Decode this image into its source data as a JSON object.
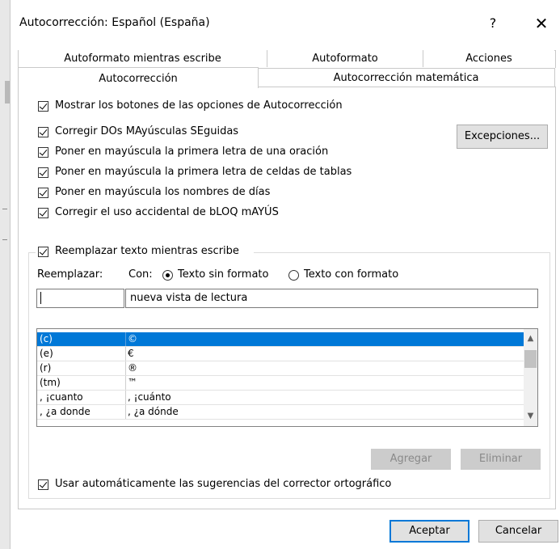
{
  "window": {
    "title": "Autocorrección: Español (España)",
    "help_label": "?",
    "close_label": "✕"
  },
  "tabs": {
    "row_back": [
      "Autoformato mientras escribe",
      "Autoformato",
      "Acciones"
    ],
    "active": "Autocorrección",
    "math": "Autocorrección matemática"
  },
  "options": {
    "show_buttons": "Mostrar los botones de las opciones de Autocorrección",
    "two_caps": "Corregir DOs MAyúsculas SEguidas",
    "sentence_caps": "Poner en mayúscula la primera letra de una oración",
    "table_caps": "Poner en mayúscula la primera letra de celdas de tablas",
    "day_names": "Poner en mayúscula los nombres de días",
    "caps_lock": "Corregir el uso accidental de bLOQ mAYÚS"
  },
  "exceptions_button": "Excepciones...",
  "replace": {
    "group_label": "Reemplazar texto mientras escribe",
    "replace_label": "Reemplazar:",
    "with_label": "Con:",
    "plain_text": "Texto sin formato",
    "formatted_text": "Texto con formato",
    "replace_value": "",
    "with_value": "nueva vista de lectura"
  },
  "list": {
    "rows": [
      {
        "from": "(c)",
        "to": "©"
      },
      {
        "from": "(e)",
        "to": "€"
      },
      {
        "from": "(r)",
        "to": "®"
      },
      {
        "from": "(tm)",
        "to": "™"
      },
      {
        "from": ", ¡cuanto",
        "to": ", ¡cuánto"
      },
      {
        "from": ", ¿a donde",
        "to": ", ¿a dónde"
      }
    ]
  },
  "add_button": "Agregar",
  "delete_button": "Eliminar",
  "use_suggestions": "Usar automáticamente las sugerencias del corrector ortográfico",
  "ok_button": "Aceptar",
  "cancel_button": "Cancelar"
}
